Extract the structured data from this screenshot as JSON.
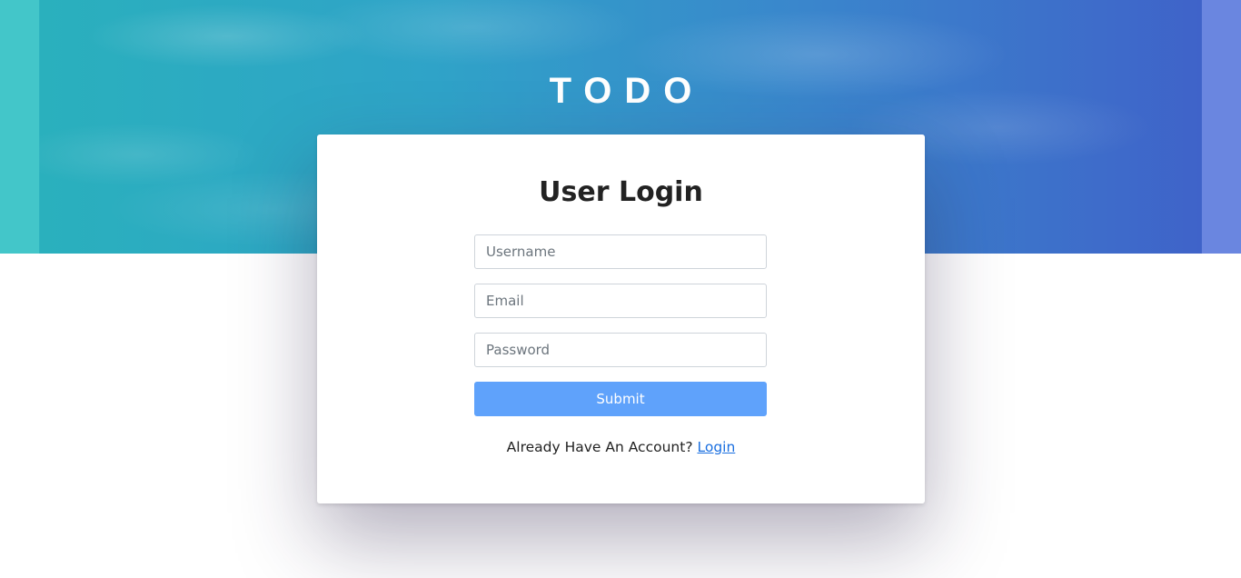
{
  "header": {
    "brand": "TODO"
  },
  "login_card": {
    "title": "User Login",
    "username_placeholder": "Username",
    "email_placeholder": "Email",
    "password_placeholder": "Password",
    "submit_label": "Submit",
    "account_prompt": "Already Have An Account?",
    "account_link": "Login"
  },
  "colors": {
    "submit_button": "#5fa2fb",
    "link": "#1a6fe0",
    "hero_start": "#3fc3c8",
    "hero_end": "#3f63c9"
  }
}
